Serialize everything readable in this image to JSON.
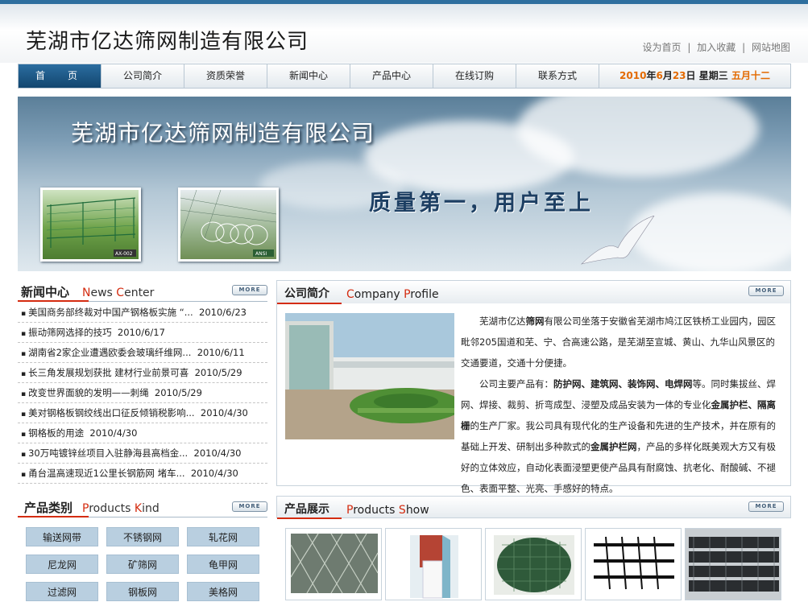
{
  "header": {
    "company_name": "芜湖市亿达筛网制造有限公司",
    "links": [
      "设为首页",
      "加入收藏",
      "网站地图"
    ],
    "link_separator": "|"
  },
  "nav": {
    "items": [
      "首　页",
      "公司简介",
      "资质荣誉",
      "新闻中心",
      "产品中心",
      "在线订购",
      "联系方式"
    ],
    "date": {
      "year": "2010",
      "y_suffix": "年",
      "month": "6",
      "m_suffix": "月",
      "day": "23",
      "d_suffix": "日",
      "weekday": "星期三",
      "lunar": "五月十二"
    }
  },
  "banner": {
    "title": "芜湖市亿达筛网制造有限公司",
    "slogan": "质量第一，用户至上",
    "photo1_tag": "AX-002",
    "photo2_tag": "ANSI"
  },
  "news": {
    "title_cn": "新闻中心",
    "title_en_1": "N",
    "title_en_2": "ews ",
    "title_en_3": "C",
    "title_en_4": "enter",
    "more": "MORE",
    "bullet": "▪",
    "items": [
      {
        "title": "美国商务部终裁对中国产钢格板实施 “...",
        "date": "2010/6/23"
      },
      {
        "title": "振动筛网选择的技巧",
        "date": "2010/6/17"
      },
      {
        "title": "湖南省2家企业遭遇欧委会玻璃纤维网...",
        "date": "2010/6/11"
      },
      {
        "title": "长三角发展规划获批 建材行业前景可喜",
        "date": "2010/5/29"
      },
      {
        "title": "改变世界面貌的发明——刺绳",
        "date": "2010/5/29"
      },
      {
        "title": "美对钢格板钢绞线出口征反倾销税影响...",
        "date": "2010/4/30"
      },
      {
        "title": "钢格板的用途",
        "date": "2010/4/30"
      },
      {
        "title": "30万吨镀锌丝项目入驻静海县高档金...",
        "date": "2010/4/30"
      },
      {
        "title": "甬台温高速现近1公里长钢筋网 堵车...",
        "date": "2010/4/30"
      }
    ]
  },
  "profile": {
    "title_cn": "公司简介",
    "title_en_1": "C",
    "title_en_2": "ompany ",
    "title_en_3": "P",
    "title_en_4": "rofile",
    "more": "MORE",
    "p1_a": "芜湖市亿达",
    "p1_b": "筛网",
    "p1_c": "有限公司坐落于安徽省芜湖市鸠江区铁桥工业园内，园区毗邻205国道和芜、宁、合高速公路，是芜湖至宣城、黄山、九华山风景区的交通要道，交通十分便捷。",
    "p2_a": "公司主要产品有：",
    "p2_b": "防护网、建筑网、装饰网、电焊网",
    "p2_c": "等。同时集拔丝、焊网、焊接、裁剪、折弯成型、浸塑及成品安装为一体的专业化",
    "p2_d": "金属护栏、隔离栅",
    "p2_e": "的生产厂家。我公司具有现代化的生产设备和先进的生产技术，并在原有的基础上开发、研制出多种款式的",
    "p2_f": "金属护栏网",
    "p2_g": "，产品的多样化既美观大方又有极好的立体效应，自动化表面浸塑更使产品具有耐腐蚀、抗老化、耐酸碱、不褪色、表面平整、光亮、手感好的特点。"
  },
  "kinds": {
    "title_cn": "产品类别",
    "title_en_1": "P",
    "title_en_2": "roducts ",
    "title_en_3": "K",
    "title_en_4": "ind",
    "more": "MORE",
    "items": [
      "输送网带",
      "不锈钢网",
      "轧花网",
      "尼龙网",
      "矿筛网",
      "龟甲网",
      "过滤网",
      "钢板网",
      "美格网"
    ]
  },
  "products": {
    "title_cn": "产品展示",
    "title_en_1": "P",
    "title_en_2": "roducts ",
    "title_en_3": "S",
    "title_en_4": "how",
    "more": "MORE"
  },
  "colors": {
    "brand_blue": "#1f5a87",
    "accent_red": "#d42c10",
    "date_orange": "#e36a00",
    "kind_button": "#b9cfe0"
  }
}
